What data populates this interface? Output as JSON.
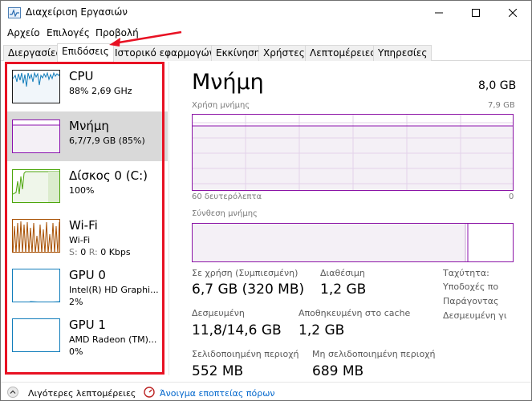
{
  "window": {
    "title": "Διαχείριση Εργασιών"
  },
  "menu": [
    "Αρχείο",
    "Επιλογές",
    "Προβολή"
  ],
  "tabs": [
    {
      "label": "Διεργασίες",
      "active": false
    },
    {
      "label": "Επιδόσεις",
      "active": true
    },
    {
      "label": "Ιστορικό εφαρμογών",
      "active": false
    },
    {
      "label": "Εκκίνηση",
      "active": false
    },
    {
      "label": "Χρήστες",
      "active": false
    },
    {
      "label": "Λεπτομέρειες",
      "active": false
    },
    {
      "label": "Υπηρεσίες",
      "active": false
    }
  ],
  "resources": [
    {
      "name": "CPU",
      "sub": "88% 2,69 GHz",
      "color": "#117dbb",
      "selected": false
    },
    {
      "name": "Μνήμη",
      "sub": "6,7/7,9 GB (85%)",
      "color": "#8b12ae",
      "selected": true
    },
    {
      "name": "Δίσκος 0 (C:)",
      "sub": "100%",
      "color": "#4da60c",
      "selected": false
    },
    {
      "name": "Wi-Fi",
      "sub": "Wi-Fi",
      "sub2_s": "S:",
      "sub2_s_val": "0",
      "sub2_r": "R:",
      "sub2_r_val": "0 Kbps",
      "color": "#a74f01",
      "selected": false
    },
    {
      "name": "GPU 0",
      "sub": "Intel(R) HD Graphi...",
      "sub2": "2%",
      "color": "#117dbb",
      "selected": false
    },
    {
      "name": "GPU 1",
      "sub": "AMD Radeon (TM)...",
      "sub2": "0%",
      "color": "#117dbb",
      "selected": false
    }
  ],
  "detail": {
    "title": "Μνήμη",
    "total": "8,0 GB",
    "usage_label": "Χρήση μνήμης",
    "usage_max": "7,9 GB",
    "time_left": "60 δευτερόλεπτα",
    "time_right": "0",
    "composition_label": "Σύνθεση μνήμης",
    "stats": {
      "in_use_label": "Σε χρήση (Συμπιεσμένη)",
      "in_use_value": "6,7 GB (320 MB)",
      "available_label": "Διαθέσιμη",
      "available_value": "1,2 GB",
      "committed_label": "Δεσμευμένη",
      "committed_value": "11,8/14,6 GB",
      "cached_label": "Αποθηκευμένη στο cache",
      "cached_value": "1,2 GB",
      "paged_label": "Σελιδοποιημένη περιοχή",
      "paged_value": "552 MB",
      "nonpaged_label": "Μη σελιδοποιημένη περιοχή",
      "nonpaged_value": "689 MB"
    },
    "side_labels": [
      "Ταχύτητα:",
      "Υποδοχές πο",
      "Παράγοντας",
      "Δεσμευμένη γι"
    ]
  },
  "footer": {
    "fewer_details": "Λιγότερες λεπτομέρειες",
    "resource_monitor": "Άνοιγμα εποπτείας πόρων"
  },
  "colors": {
    "annotation": "#e81123",
    "memory": "#8b12ae",
    "link": "#0066cc"
  }
}
